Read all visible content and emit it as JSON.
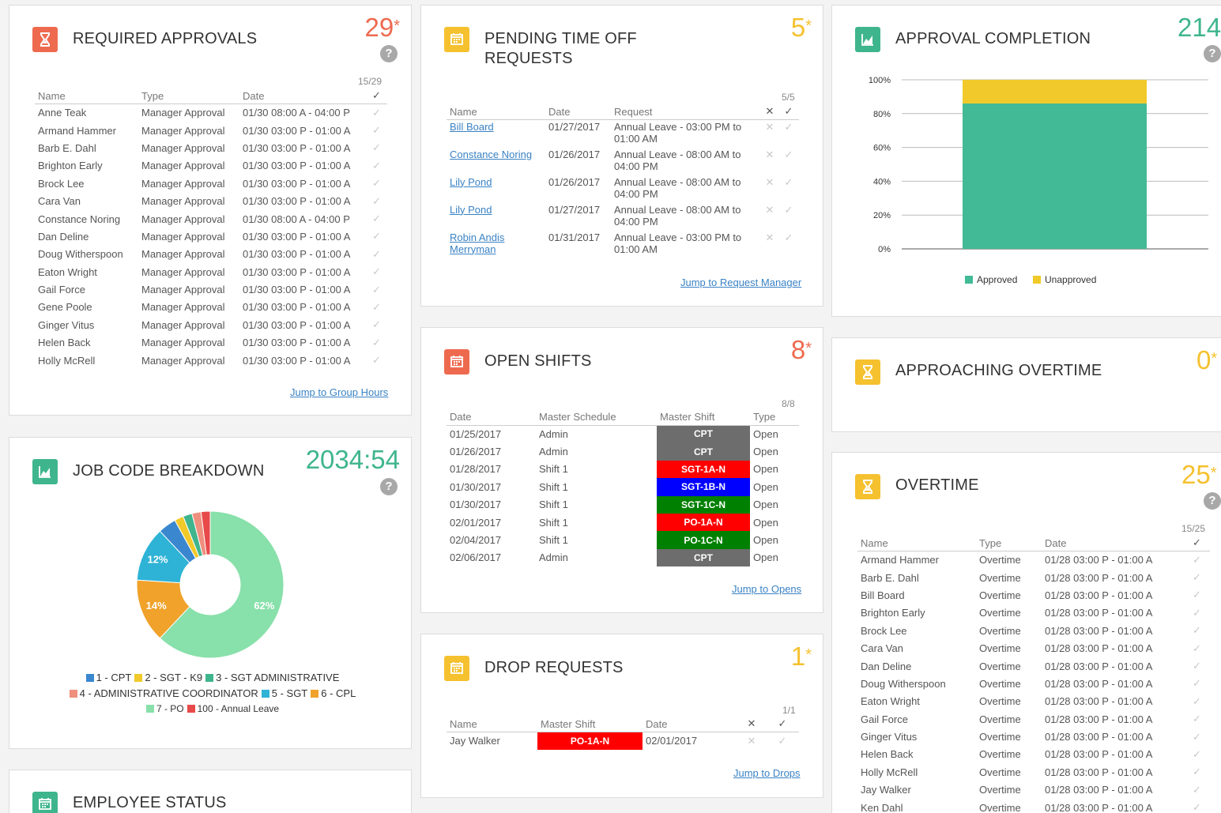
{
  "required_approvals": {
    "title": "REQUIRED APPROVALS",
    "count": "29",
    "star": "*",
    "help": "?",
    "ratio": "15/29",
    "columns": {
      "name": "Name",
      "type": "Type",
      "date": "Date",
      "check": "✓"
    },
    "rows": [
      {
        "name": "Anne Teak",
        "type": "Manager Approval",
        "date": "01/30 08:00 A - 04:00 P"
      },
      {
        "name": "Armand Hammer",
        "type": "Manager Approval",
        "date": "01/30 03:00 P - 01:00 A"
      },
      {
        "name": "Barb E. Dahl",
        "type": "Manager Approval",
        "date": "01/30 03:00 P - 01:00 A"
      },
      {
        "name": "Brighton Early",
        "type": "Manager Approval",
        "date": "01/30 03:00 P - 01:00 A"
      },
      {
        "name": "Brock Lee",
        "type": "Manager Approval",
        "date": "01/30 03:00 P - 01:00 A"
      },
      {
        "name": "Cara Van",
        "type": "Manager Approval",
        "date": "01/30 03:00 P - 01:00 A"
      },
      {
        "name": "Constance Noring",
        "type": "Manager Approval",
        "date": "01/30 08:00 A - 04:00 P"
      },
      {
        "name": "Dan Deline",
        "type": "Manager Approval",
        "date": "01/30 03:00 P - 01:00 A"
      },
      {
        "name": "Doug Witherspoon",
        "type": "Manager Approval",
        "date": "01/30 03:00 P - 01:00 A"
      },
      {
        "name": "Eaton Wright",
        "type": "Manager Approval",
        "date": "01/30 03:00 P - 01:00 A"
      },
      {
        "name": "Gail Force",
        "type": "Manager Approval",
        "date": "01/30 03:00 P - 01:00 A"
      },
      {
        "name": "Gene Poole",
        "type": "Manager Approval",
        "date": "01/30 03:00 P - 01:00 A"
      },
      {
        "name": "Ginger Vitus",
        "type": "Manager Approval",
        "date": "01/30 03:00 P - 01:00 A"
      },
      {
        "name": "Helen Back",
        "type": "Manager Approval",
        "date": "01/30 03:00 P - 01:00 A"
      },
      {
        "name": "Holly McRell",
        "type": "Manager Approval",
        "date": "01/30 03:00 P - 01:00 A"
      }
    ],
    "link": "Jump to Group Hours"
  },
  "pending_time_off": {
    "title_line1": "PENDING TIME OFF",
    "title_line2": "REQUESTS",
    "count": "5",
    "star": "*",
    "ratio": "5/5",
    "columns": {
      "name": "Name",
      "date": "Date",
      "request": "Request",
      "deny": "✕",
      "approve": "✓"
    },
    "rows": [
      {
        "name": "Bill Board",
        "name2": "",
        "date": "01/27/2017",
        "req1": "Annual Leave - 03:00 PM to",
        "req2": "01:00 AM"
      },
      {
        "name": "Constance Noring",
        "name2": "",
        "date": "01/26/2017",
        "req1": "Annual Leave - 08:00 AM to",
        "req2": "04:00 PM"
      },
      {
        "name": "Lily Pond",
        "name2": "",
        "date": "01/26/2017",
        "req1": "Annual Leave - 08:00 AM to",
        "req2": "04:00 PM"
      },
      {
        "name": "Lily Pond",
        "name2": "",
        "date": "01/27/2017",
        "req1": "Annual Leave - 08:00 AM to",
        "req2": "04:00 PM"
      },
      {
        "name": "Robin Andis",
        "name2": "Merryman",
        "date": "01/31/2017",
        "req1": "Annual Leave - 03:00 PM to",
        "req2": "01:00 AM"
      }
    ],
    "link": "Jump to Request Manager"
  },
  "approval_completion": {
    "title": "APPROVAL COMPLETION",
    "count": "214",
    "help": "?",
    "colors": {
      "approved": "#42ba96",
      "unapproved": "#f1c92a"
    }
  },
  "chart_data": [
    {
      "type": "bar",
      "title": "APPROVAL COMPLETION",
      "categories": [
        ""
      ],
      "series": [
        {
          "name": "Approved",
          "values": [
            86
          ]
        },
        {
          "name": "Unapproved",
          "values": [
            14
          ]
        }
      ],
      "stacked": true,
      "ylim": [
        0,
        100
      ],
      "yticks": [
        "0%",
        "20%",
        "40%",
        "60%",
        "80%",
        "100%"
      ],
      "legend": "bottom"
    },
    {
      "type": "pie",
      "title": "JOB CODE BREAKDOWN",
      "labels": [
        "7 - PO",
        "6 - CPL",
        "5 - SGT",
        "1 - CPT",
        "2 - SGT - K9",
        "3 - SGT ADMINISTRATIVE",
        "4 - ADMINISTRATIVE COORDINATOR",
        "100 - Annual Leave"
      ],
      "values": [
        62,
        14,
        12,
        4,
        2,
        2,
        2,
        2
      ],
      "slice_labels": [
        "62%",
        "14%",
        "12%",
        "",
        "",
        "",
        "",
        ""
      ],
      "legend": "bottom"
    }
  ],
  "open_shifts": {
    "title": "OPEN SHIFTS",
    "count": "8",
    "star": "*",
    "ratio": "8/8",
    "columns": {
      "date": "Date",
      "schedule": "Master Schedule",
      "shift": "Master Shift",
      "type": "Type"
    },
    "rows": [
      {
        "date": "01/25/2017",
        "schedule": "Admin",
        "shift": "CPT",
        "color": "#6d6d6d",
        "type": "Open"
      },
      {
        "date": "01/26/2017",
        "schedule": "Admin",
        "shift": "CPT",
        "color": "#6d6d6d",
        "type": "Open"
      },
      {
        "date": "01/28/2017",
        "schedule": "Shift 1",
        "shift": "SGT-1A-N",
        "color": "#ff0000",
        "type": "Open"
      },
      {
        "date": "01/30/2017",
        "schedule": "Shift 1",
        "shift": "SGT-1B-N",
        "color": "#0000ff",
        "type": "Open"
      },
      {
        "date": "01/30/2017",
        "schedule": "Shift 1",
        "shift": "SGT-1C-N",
        "color": "#008000",
        "type": "Open"
      },
      {
        "date": "02/01/2017",
        "schedule": "Shift 1",
        "shift": "PO-1A-N",
        "color": "#ff0000",
        "type": "Open"
      },
      {
        "date": "02/04/2017",
        "schedule": "Shift 1",
        "shift": "PO-1C-N",
        "color": "#008000",
        "type": "Open"
      },
      {
        "date": "02/06/2017",
        "schedule": "Admin",
        "shift": "CPT",
        "color": "#6d6d6d",
        "type": "Open"
      }
    ],
    "link": "Jump to Opens"
  },
  "approaching_overtime": {
    "title": "APPROACHING OVERTIME",
    "count": "0",
    "star": "*"
  },
  "job_code_breakdown": {
    "title": "JOB CODE BREAKDOWN",
    "count": "2034:54",
    "help": "?",
    "legend": [
      {
        "label": "1 - CPT",
        "color": "#3a87cf"
      },
      {
        "label": "2 - SGT - K9",
        "color": "#f1c92a"
      },
      {
        "label": "3 - SGT ADMINISTRATIVE",
        "color": "#3fb58e"
      },
      {
        "label": "4 - ADMINISTRATIVE COORDINATOR",
        "color": "#ef8f7e"
      },
      {
        "label": "5 - SGT",
        "color": "#2eb3d6"
      },
      {
        "label": "6 - CPL",
        "color": "#f0a22b"
      },
      {
        "label": "7 - PO",
        "color": "#88e0aa"
      },
      {
        "label": "100 - Annual Leave",
        "color": "#e84949"
      }
    ],
    "slice_colors": [
      "#88e0aa",
      "#f0a22b",
      "#2eb3d6",
      "#3a87cf",
      "#f1c92a",
      "#3fb58e",
      "#ef8f7e",
      "#e84949"
    ]
  },
  "drop_requests": {
    "title": "DROP REQUESTS",
    "count": "1",
    "star": "*",
    "ratio": "1/1",
    "columns": {
      "name": "Name",
      "shift": "Master Shift",
      "date": "Date",
      "deny": "✕",
      "approve": "✓"
    },
    "rows": [
      {
        "name": "Jay Walker",
        "shift": "PO-1A-N",
        "color": "#ff0000",
        "date": "02/01/2017"
      }
    ],
    "link": "Jump to Drops"
  },
  "overtime": {
    "title": "OVERTIME",
    "count": "25",
    "star": "*",
    "help": "?",
    "ratio": "15/25",
    "columns": {
      "name": "Name",
      "type": "Type",
      "date": "Date",
      "check": "✓"
    },
    "rows": [
      {
        "name": "Armand Hammer",
        "type": "Overtime",
        "date": "01/28 03:00 P - 01:00 A"
      },
      {
        "name": "Barb E. Dahl",
        "type": "Overtime",
        "date": "01/28 03:00 P - 01:00 A"
      },
      {
        "name": "Bill Board",
        "type": "Overtime",
        "date": "01/28 03:00 P - 01:00 A"
      },
      {
        "name": "Brighton Early",
        "type": "Overtime",
        "date": "01/28 03:00 P - 01:00 A"
      },
      {
        "name": "Brock Lee",
        "type": "Overtime",
        "date": "01/28 03:00 P - 01:00 A"
      },
      {
        "name": "Cara Van",
        "type": "Overtime",
        "date": "01/28 03:00 P - 01:00 A"
      },
      {
        "name": "Dan Deline",
        "type": "Overtime",
        "date": "01/28 03:00 P - 01:00 A"
      },
      {
        "name": "Doug Witherspoon",
        "type": "Overtime",
        "date": "01/28 03:00 P - 01:00 A"
      },
      {
        "name": "Eaton Wright",
        "type": "Overtime",
        "date": "01/28 03:00 P - 01:00 A"
      },
      {
        "name": "Gail Force",
        "type": "Overtime",
        "date": "01/28 03:00 P - 01:00 A"
      },
      {
        "name": "Ginger Vitus",
        "type": "Overtime",
        "date": "01/28 03:00 P - 01:00 A"
      },
      {
        "name": "Helen Back",
        "type": "Overtime",
        "date": "01/28 03:00 P - 01:00 A"
      },
      {
        "name": "Holly McRell",
        "type": "Overtime",
        "date": "01/28 03:00 P - 01:00 A"
      },
      {
        "name": "Jay Walker",
        "type": "Overtime",
        "date": "01/28 03:00 P - 01:00 A"
      },
      {
        "name": "Ken Dahl",
        "type": "Overtime",
        "date": "01/28 03:00 P - 01:00 A"
      }
    ]
  },
  "employee_status": {
    "title": "EMPLOYEE STATUS"
  },
  "palette": {
    "red": "#ee6a4f",
    "yellow": "#f5c12f",
    "green": "#3fb58e",
    "check": "✓",
    "cross": "✕"
  }
}
